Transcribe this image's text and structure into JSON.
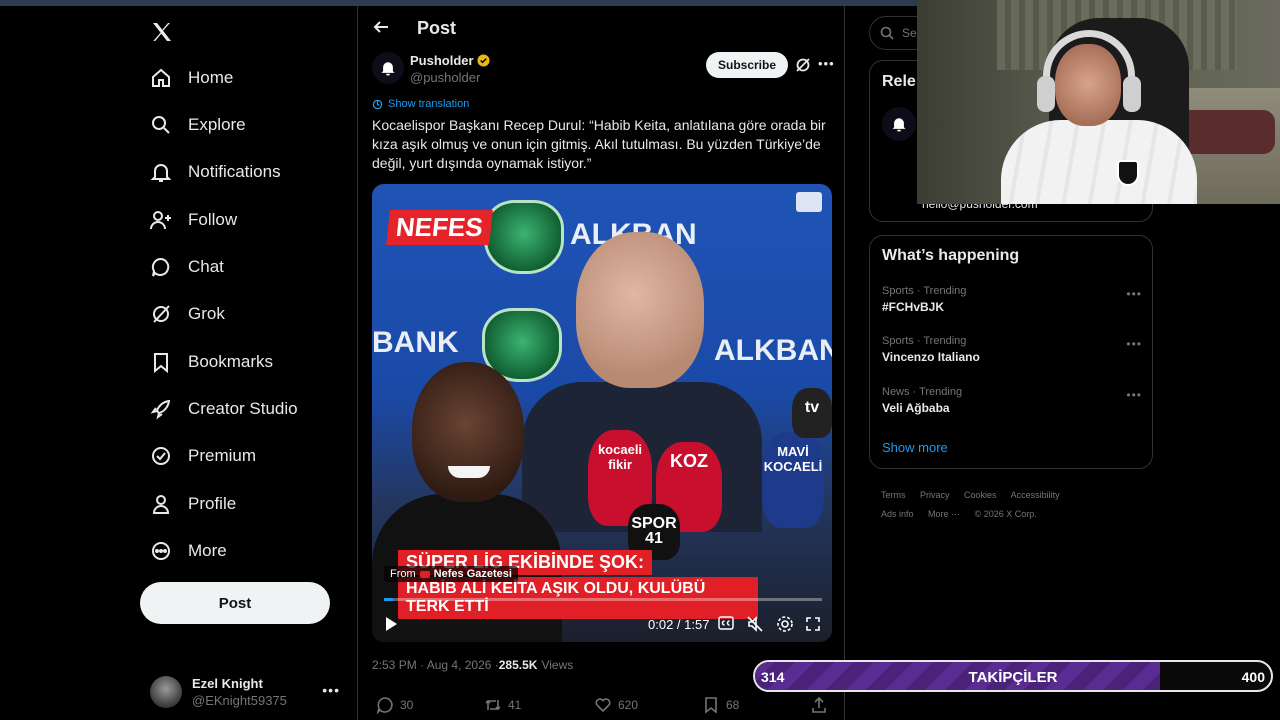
{
  "sidebar": {
    "items": [
      {
        "label": "Home",
        "icon": "home-icon"
      },
      {
        "label": "Explore",
        "icon": "search-icon"
      },
      {
        "label": "Notifications",
        "icon": "bell-icon"
      },
      {
        "label": "Follow",
        "icon": "add-person-icon"
      },
      {
        "label": "Chat",
        "icon": "chat-bubble-icon"
      },
      {
        "label": "Grok",
        "icon": "grok-icon"
      },
      {
        "label": "Bookmarks",
        "icon": "bookmark-icon"
      },
      {
        "label": "Creator Studio",
        "icon": "rocket-icon"
      },
      {
        "label": "Premium",
        "icon": "verified-badge-icon"
      },
      {
        "label": "Profile",
        "icon": "person-icon"
      },
      {
        "label": "More",
        "icon": "more-circle-icon"
      }
    ],
    "post_button": "Post",
    "account": {
      "display_name": "Ezel Knight",
      "handle": "@EKnight59375"
    }
  },
  "header": {
    "title": "Post"
  },
  "post": {
    "author_name": "Pusholder",
    "author_handle": "@pusholder",
    "subscribe_label": "Subscribe",
    "show_translation": "Show translation",
    "text": "Kocaelispor Başkanı Recep Durul: “Habib Keita, anlatılana göre orada bir kıza aşık olmuş ve onun için gitmiş. Akıl tutulması. Bu yüzden Türkiye’de değil, yurt dışında oynamak istiyor.”",
    "video": {
      "brand_tag": "NEFES",
      "wall_text_1": "ALKBAN",
      "wall_text_2": "BANK",
      "wall_text_3": "ALKBAN",
      "mic_labels": [
        "kocaeli fikir",
        "KOZ",
        "MAVİ KOCAELİ",
        "SPOR 41",
        "tv"
      ],
      "caption_line_1": "SÜPER LİG EKİBİNDE ŞOK:",
      "caption_line_2": "HABİB ALİ KEİTA AŞIK OLDU, KULÜBÜ TERK ETTİ",
      "from_label": "From",
      "from_brand": "Nefes Gazetesi",
      "time": "0:02 / 1:57",
      "progress": 0.02
    },
    "timestamp": "2:53 PM · Aug 4, 2026 · ",
    "views_count": "285.5K",
    "views_label": "Views",
    "replies": "30",
    "reposts": "41",
    "likes": "620",
    "bookmarks": "68"
  },
  "right": {
    "search_placeholder": "Sear",
    "relevant_title": "Rele",
    "relevant_email": "hello@pusholder.com",
    "happening_title": "What’s happening",
    "trends": [
      {
        "category": "Sports · Trending",
        "name": "#FCHvBJK"
      },
      {
        "category": "Sports · Trending",
        "name": "Vincenzo Italiano"
      },
      {
        "category": "News · Trending",
        "name": "Veli Ağbaba"
      }
    ],
    "show_more": "Show more",
    "footer_row1": [
      "Terms",
      "Privacy",
      "Cookies",
      "Accessibility"
    ],
    "footer_row2": [
      "Ads info",
      "More ···",
      "© 2026 X Corp."
    ]
  },
  "follower_bar": {
    "current": "314",
    "label": "TAKİPÇİLER",
    "goal": "400",
    "progress": 0.785
  },
  "colors": {
    "accent": "#1d9bf0",
    "background": "#000000",
    "follower_bar": "#5a2b91"
  }
}
